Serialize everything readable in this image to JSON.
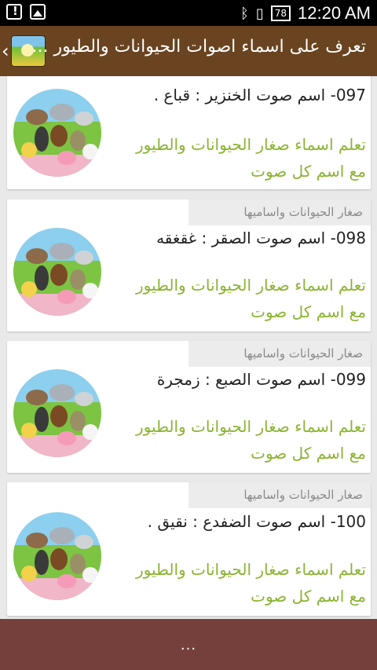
{
  "status_bar": {
    "time": "12:20 AM",
    "battery": "78",
    "icons": [
      "alert-icon",
      "image-icon",
      "bluetooth-icon",
      "vibrate-icon",
      "battery-icon"
    ]
  },
  "app_bar": {
    "title": "تعرف على اسماء اصوات الحيوانات والطيور ..."
  },
  "cards": [
    {
      "header": "",
      "title": "097- اسم صوت الخنزير : قباع .",
      "desc_line1": "تعلم اسماء صغار الحيوانات والطيور",
      "desc_line2": "مع اسم كل صوت"
    },
    {
      "header": "صغار الحيوانات واساميها",
      "title": "098- اسم صوت الصقر : غقغقه",
      "desc_line1": "تعلم اسماء صغار الحيوانات والطيور",
      "desc_line2": "مع اسم كل صوت"
    },
    {
      "header": "صغار الحيوانات واساميها",
      "title": "099- اسم صوت الصبع : زمجرة",
      "desc_line1": "تعلم اسماء صغار الحيوانات والطيور",
      "desc_line2": "مع اسم كل صوت"
    },
    {
      "header": "صغار الحيوانات واساميها",
      "title": "100- اسم صوت الضفدع : نقيق .",
      "desc_line1": "تعلم اسماء صغار الحيوانات والطيور",
      "desc_line2": "مع اسم كل صوت"
    }
  ],
  "footer": {
    "more_label": "..."
  },
  "colors": {
    "app_bar": "#6a4420",
    "footer": "#75403c",
    "desc_text": "#8ab430",
    "header_text": "#8a8a8a"
  }
}
